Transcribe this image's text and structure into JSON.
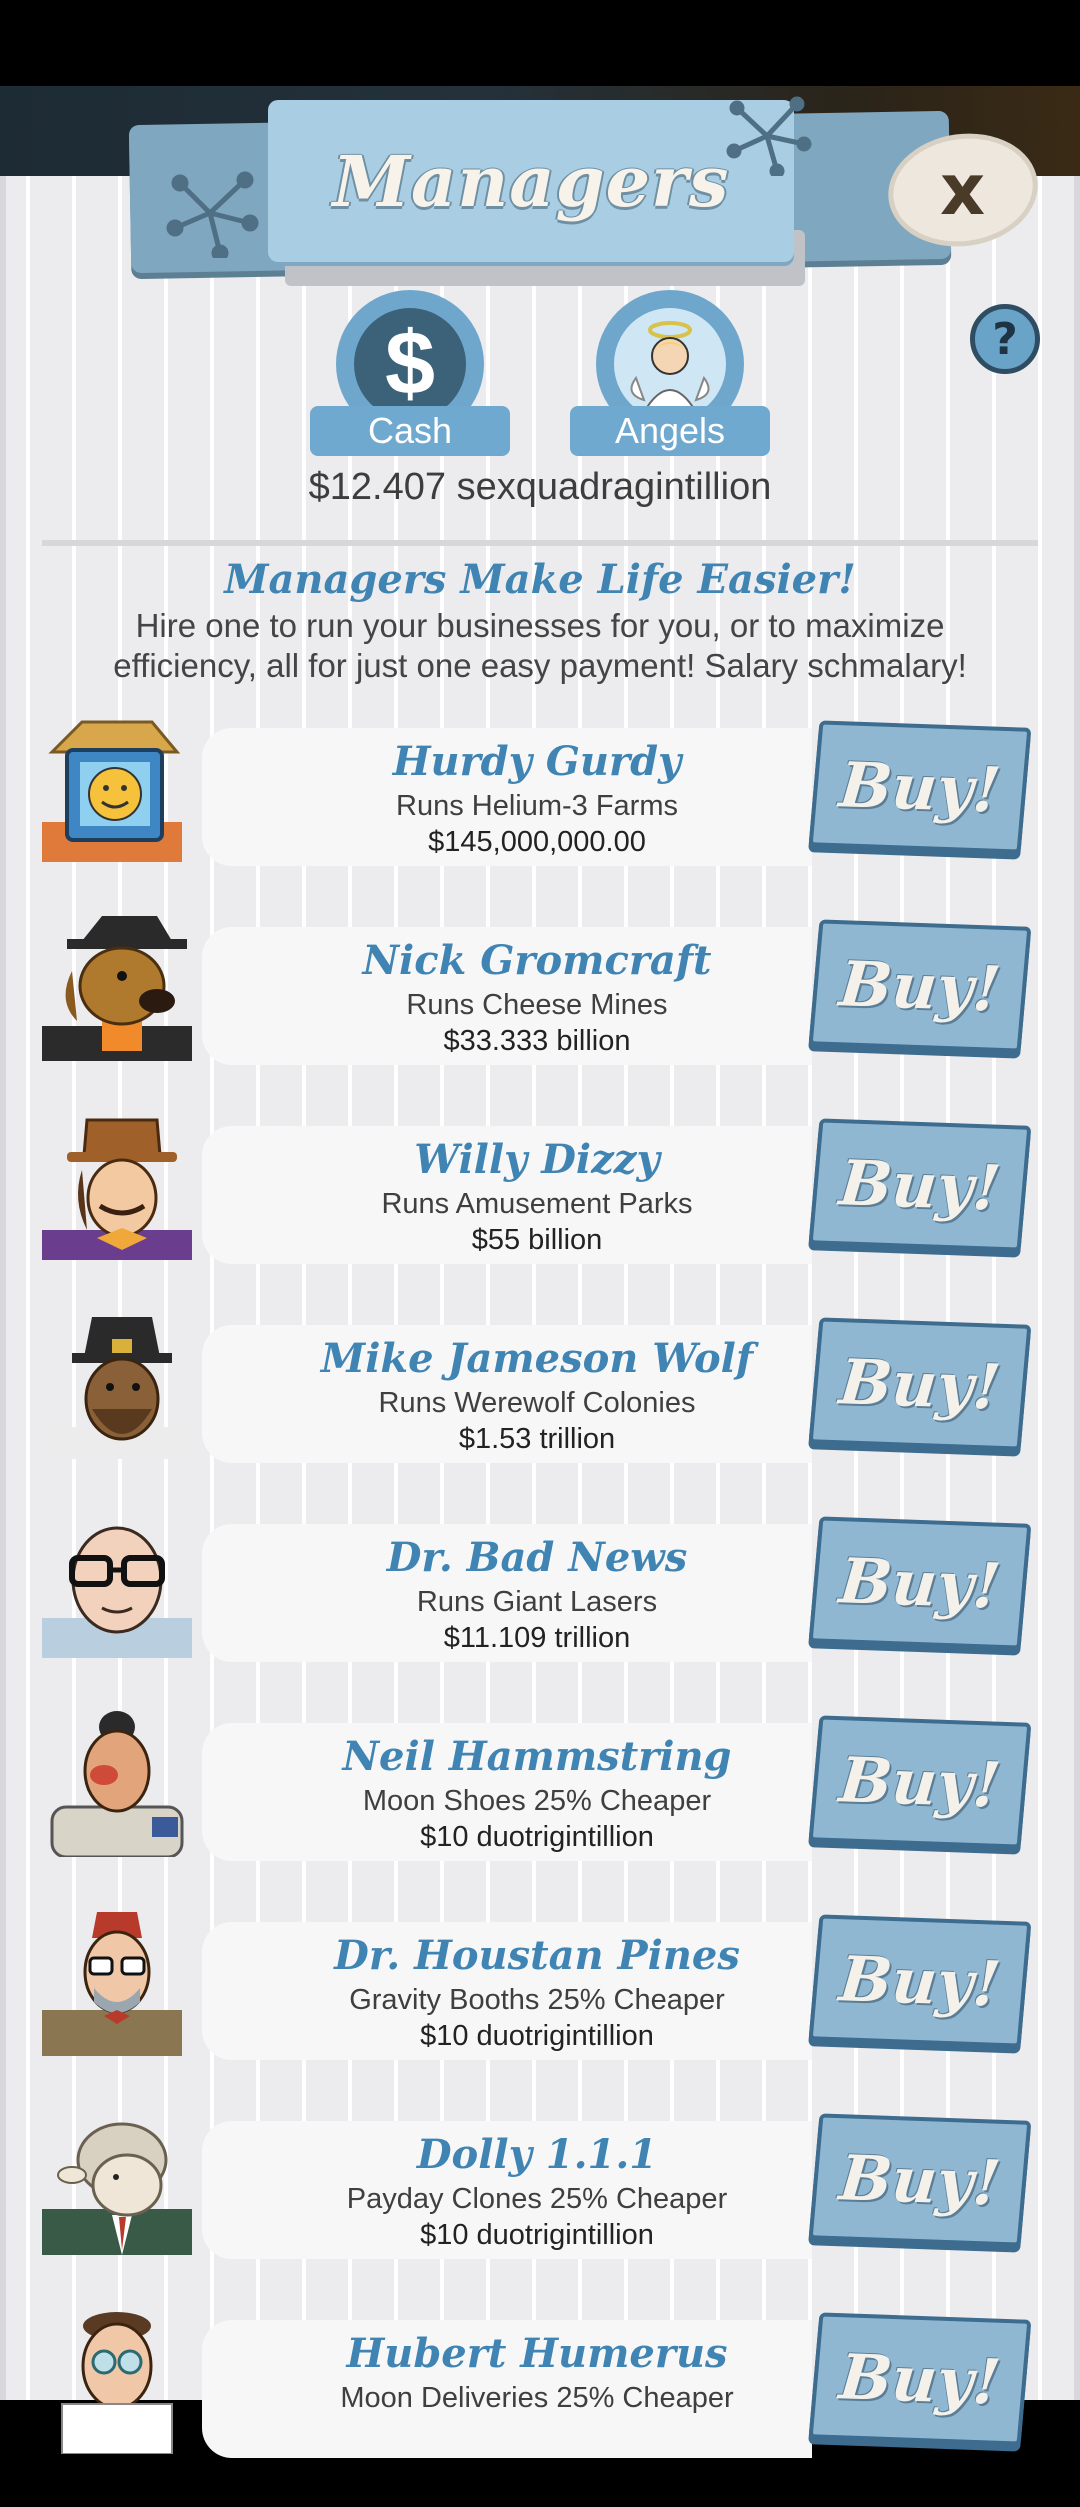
{
  "header": {
    "title": "Managers"
  },
  "tabs": [
    {
      "label": "Cash",
      "icon": "dollar-icon"
    },
    {
      "label": "Angels",
      "icon": "angel-icon"
    }
  ],
  "balance": "$12.407 sexquadragintillion",
  "promo": {
    "title": "Managers Make Life Easier!",
    "text": "Hire one to run your businesses for you, or to maximize efficiency, all for just one easy payment! Salary schmalary!"
  },
  "buy_label": "Buy!",
  "managers": [
    {
      "name": "Hurdy Gurdy",
      "desc": "Runs Helium-3 Farms",
      "cost": "$145,000,000.00",
      "buy": "Buy!"
    },
    {
      "name": "Nick Gromcraft",
      "desc": "Runs Cheese Mines",
      "cost": "$33.333 billion",
      "buy": "Buy!"
    },
    {
      "name": "Willy Dizzy",
      "desc": "Runs Amusement Parks",
      "cost": "$55 billion",
      "buy": "Buy!"
    },
    {
      "name": "Mike Jameson Wolf",
      "desc": "Runs Werewolf Colonies",
      "cost": "$1.53 trillion",
      "buy": "Buy!"
    },
    {
      "name": "Dr. Bad News",
      "desc": "Runs Giant Lasers",
      "cost": "$11.109 trillion",
      "buy": "Buy!"
    },
    {
      "name": "Neil Hammstring",
      "desc": "Moon Shoes 25% Cheaper",
      "cost": "$10 duotrigintillion",
      "buy": "Buy!"
    },
    {
      "name": "Dr. Houstan Pines",
      "desc": "Gravity Booths 25% Cheaper",
      "cost": "$10 duotrigintillion",
      "buy": "Buy!"
    },
    {
      "name": "Dolly 1.1.1",
      "desc": "Payday Clones 25% Cheaper",
      "cost": "$10 duotrigintillion",
      "buy": "Buy!"
    },
    {
      "name": "Hubert Humerus",
      "desc": "Moon Deliveries 25% Cheaper",
      "cost": "",
      "buy": "Buy!"
    }
  ]
}
